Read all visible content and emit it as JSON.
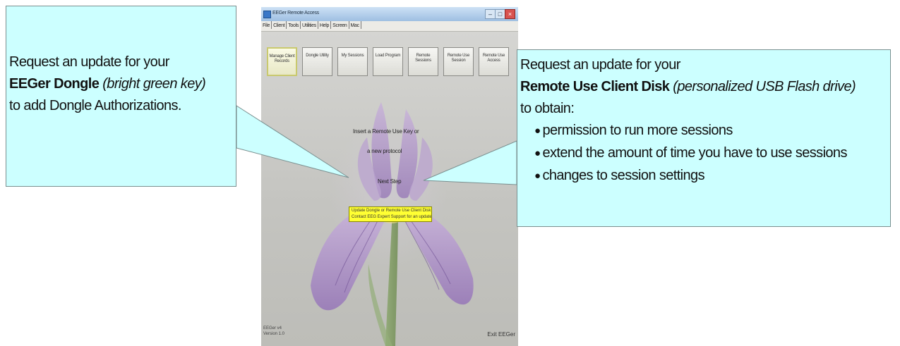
{
  "window": {
    "title": "EEGer Remote Access"
  },
  "menu": {
    "items": [
      "File",
      "Client",
      "Tools",
      "Utilities",
      "Help",
      "Screen",
      "Mac"
    ]
  },
  "toolbar": {
    "buttons": [
      {
        "label": "Manage Client Records"
      },
      {
        "label": "Dongle Utility"
      },
      {
        "label": "My Sessions"
      },
      {
        "label": "Load Program"
      },
      {
        "label": "Remote Sessions"
      },
      {
        "label": "Remote Use Session"
      },
      {
        "label": "Remote Use Access"
      }
    ]
  },
  "content": {
    "prompt_line1": "Insert a Remote Use Key or",
    "prompt_line2": "a new protocol",
    "prompt_line3": "Next Step",
    "highlight_line1": "Update Dongle or Remote Use Client Disk",
    "highlight_line2": "Contact EEG Expert Support for an update",
    "status_left_line1": "EEGer v4",
    "status_left_line2": "Version 1.0",
    "status_right": "Exit EEGer"
  },
  "callout_left": {
    "line1": "Request an update for your",
    "bold": "EEGer Dongle",
    "italic": "(bright green key)",
    "line3": "to add Dongle Authorizations."
  },
  "callout_right": {
    "line1": "Request an update for your",
    "bold": "Remote Use Client Disk",
    "italic": "(personalized USB Flash drive)",
    "line3": "to obtain:",
    "bullets": [
      "permission to run more sessions",
      "extend the amount of time you have to use sessions",
      "changes to session settings"
    ]
  },
  "colors": {
    "callout_bg": "#ccffff",
    "highlight": "#ffff33",
    "active_button_border": "#c9c96e"
  }
}
